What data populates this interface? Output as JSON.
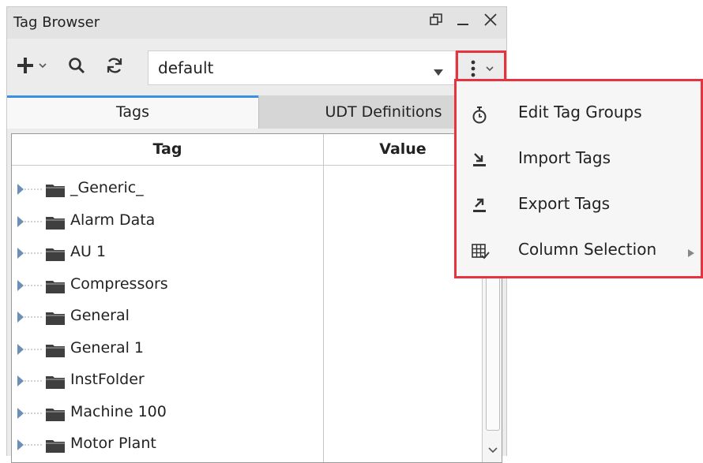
{
  "window": {
    "title": "Tag Browser"
  },
  "toolbar": {
    "provider_value": "default"
  },
  "tabs": [
    {
      "label": "Tags",
      "active": true
    },
    {
      "label": "UDT Definitions",
      "active": false
    }
  ],
  "table": {
    "columns": [
      "Tag",
      "Value"
    ],
    "rows": [
      {
        "name": "_Generic_"
      },
      {
        "name": "Alarm Data"
      },
      {
        "name": "AU 1"
      },
      {
        "name": "Compressors"
      },
      {
        "name": "General"
      },
      {
        "name": "General 1"
      },
      {
        "name": "InstFolder"
      },
      {
        "name": "Machine 100"
      },
      {
        "name": "Motor Plant"
      }
    ]
  },
  "menu": {
    "items": [
      {
        "label": "Edit Tag Groups",
        "icon": "stopwatch-icon",
        "submenu": false
      },
      {
        "label": "Import Tags",
        "icon": "import-icon",
        "submenu": false
      },
      {
        "label": "Export Tags",
        "icon": "export-icon",
        "submenu": false
      },
      {
        "label": "Column Selection",
        "icon": "grid-check-icon",
        "submenu": true
      }
    ]
  },
  "colors": {
    "highlight": "#e5343d",
    "active_tab": "#3a8ee6"
  }
}
